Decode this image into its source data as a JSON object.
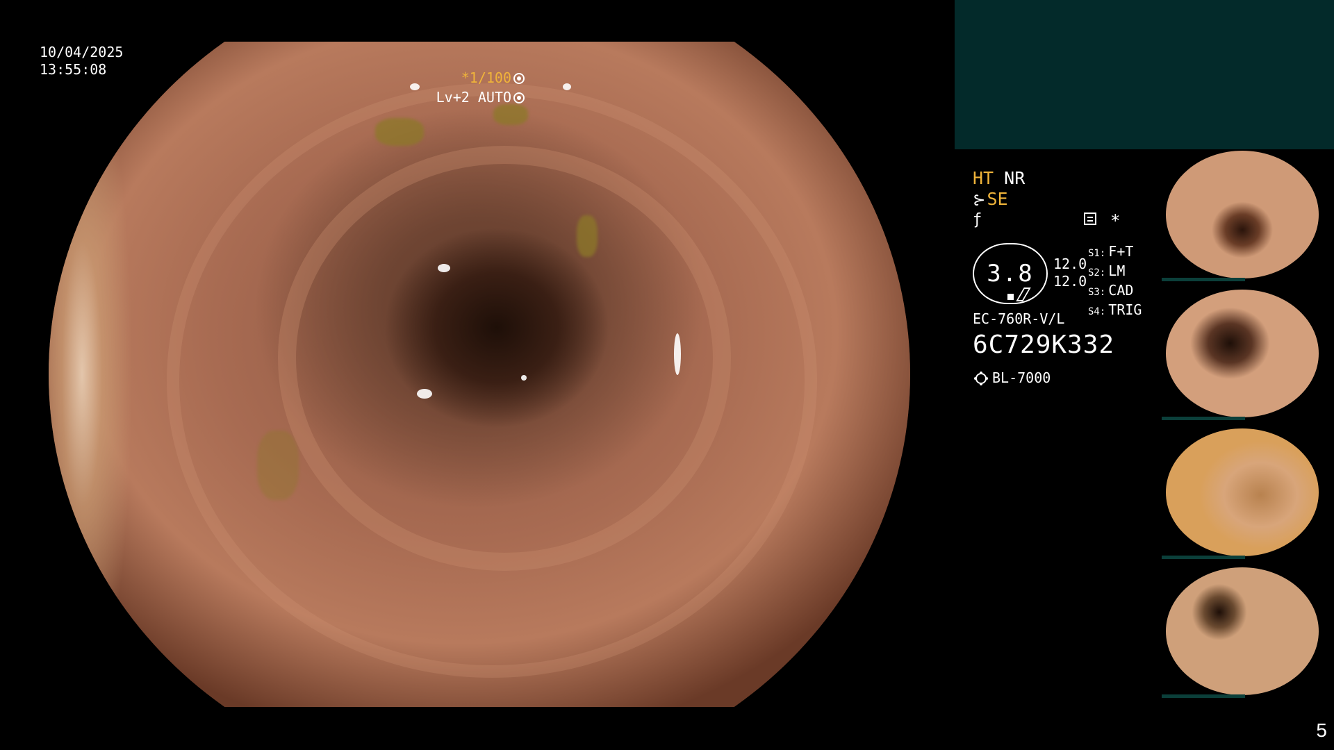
{
  "overlay": {
    "date": "10/04/2025",
    "time": "13:55:08",
    "shutter": "*1/100",
    "level": "Lv+2 AUTO"
  },
  "panel": {
    "ht": "HT",
    "nr": "NR",
    "se": "SE",
    "badge_value": "3.8",
    "val1": "12.0",
    "val2": "12.0",
    "slots": [
      {
        "key": "S1:",
        "value": "F+T"
      },
      {
        "key": "S2:",
        "value": "LM"
      },
      {
        "key": "S3:",
        "value": "CAD"
      },
      {
        "key": "S4:",
        "value": "TRIG"
      }
    ],
    "star": "*",
    "model": "EC-760R-V/L",
    "serial": "6C729K332",
    "light": "BL-7000"
  },
  "colors": {
    "accent": "#f0b43a",
    "top_box": "#032a2a"
  },
  "page_number": "5"
}
